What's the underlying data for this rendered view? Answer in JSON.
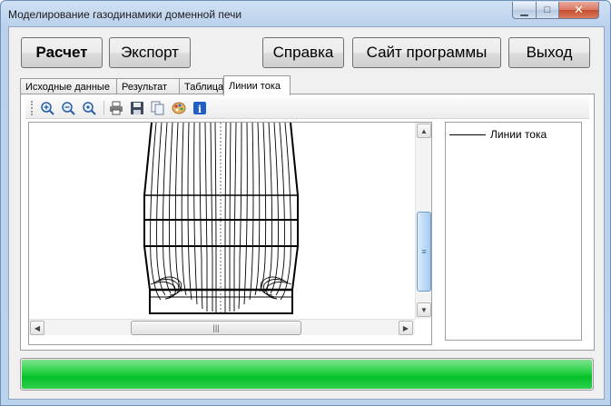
{
  "window": {
    "title": "Моделирование газодинамики доменной печи"
  },
  "buttons": {
    "calc": "Расчет",
    "export": "Экспорт",
    "help": "Справка",
    "site": "Сайт программы",
    "exit": "Выход"
  },
  "tabs": [
    {
      "label": "Исходные данные",
      "active": false
    },
    {
      "label": "Результат",
      "active": false
    },
    {
      "label": "Таблица",
      "active": false
    },
    {
      "label": "Линии тока",
      "active": true
    }
  ],
  "toolbar": {
    "icons": [
      "zoom-in-icon",
      "zoom-out-icon",
      "zoom-reset-icon",
      "print-icon",
      "save-icon",
      "copy-icon",
      "palette-icon",
      "info-icon"
    ]
  },
  "legend": {
    "label": "Линии тока"
  },
  "scroll": {
    "h_grip": "|||",
    "v_grip": "≡"
  },
  "progress": {
    "value": 1.0,
    "color": "#07c22b"
  }
}
